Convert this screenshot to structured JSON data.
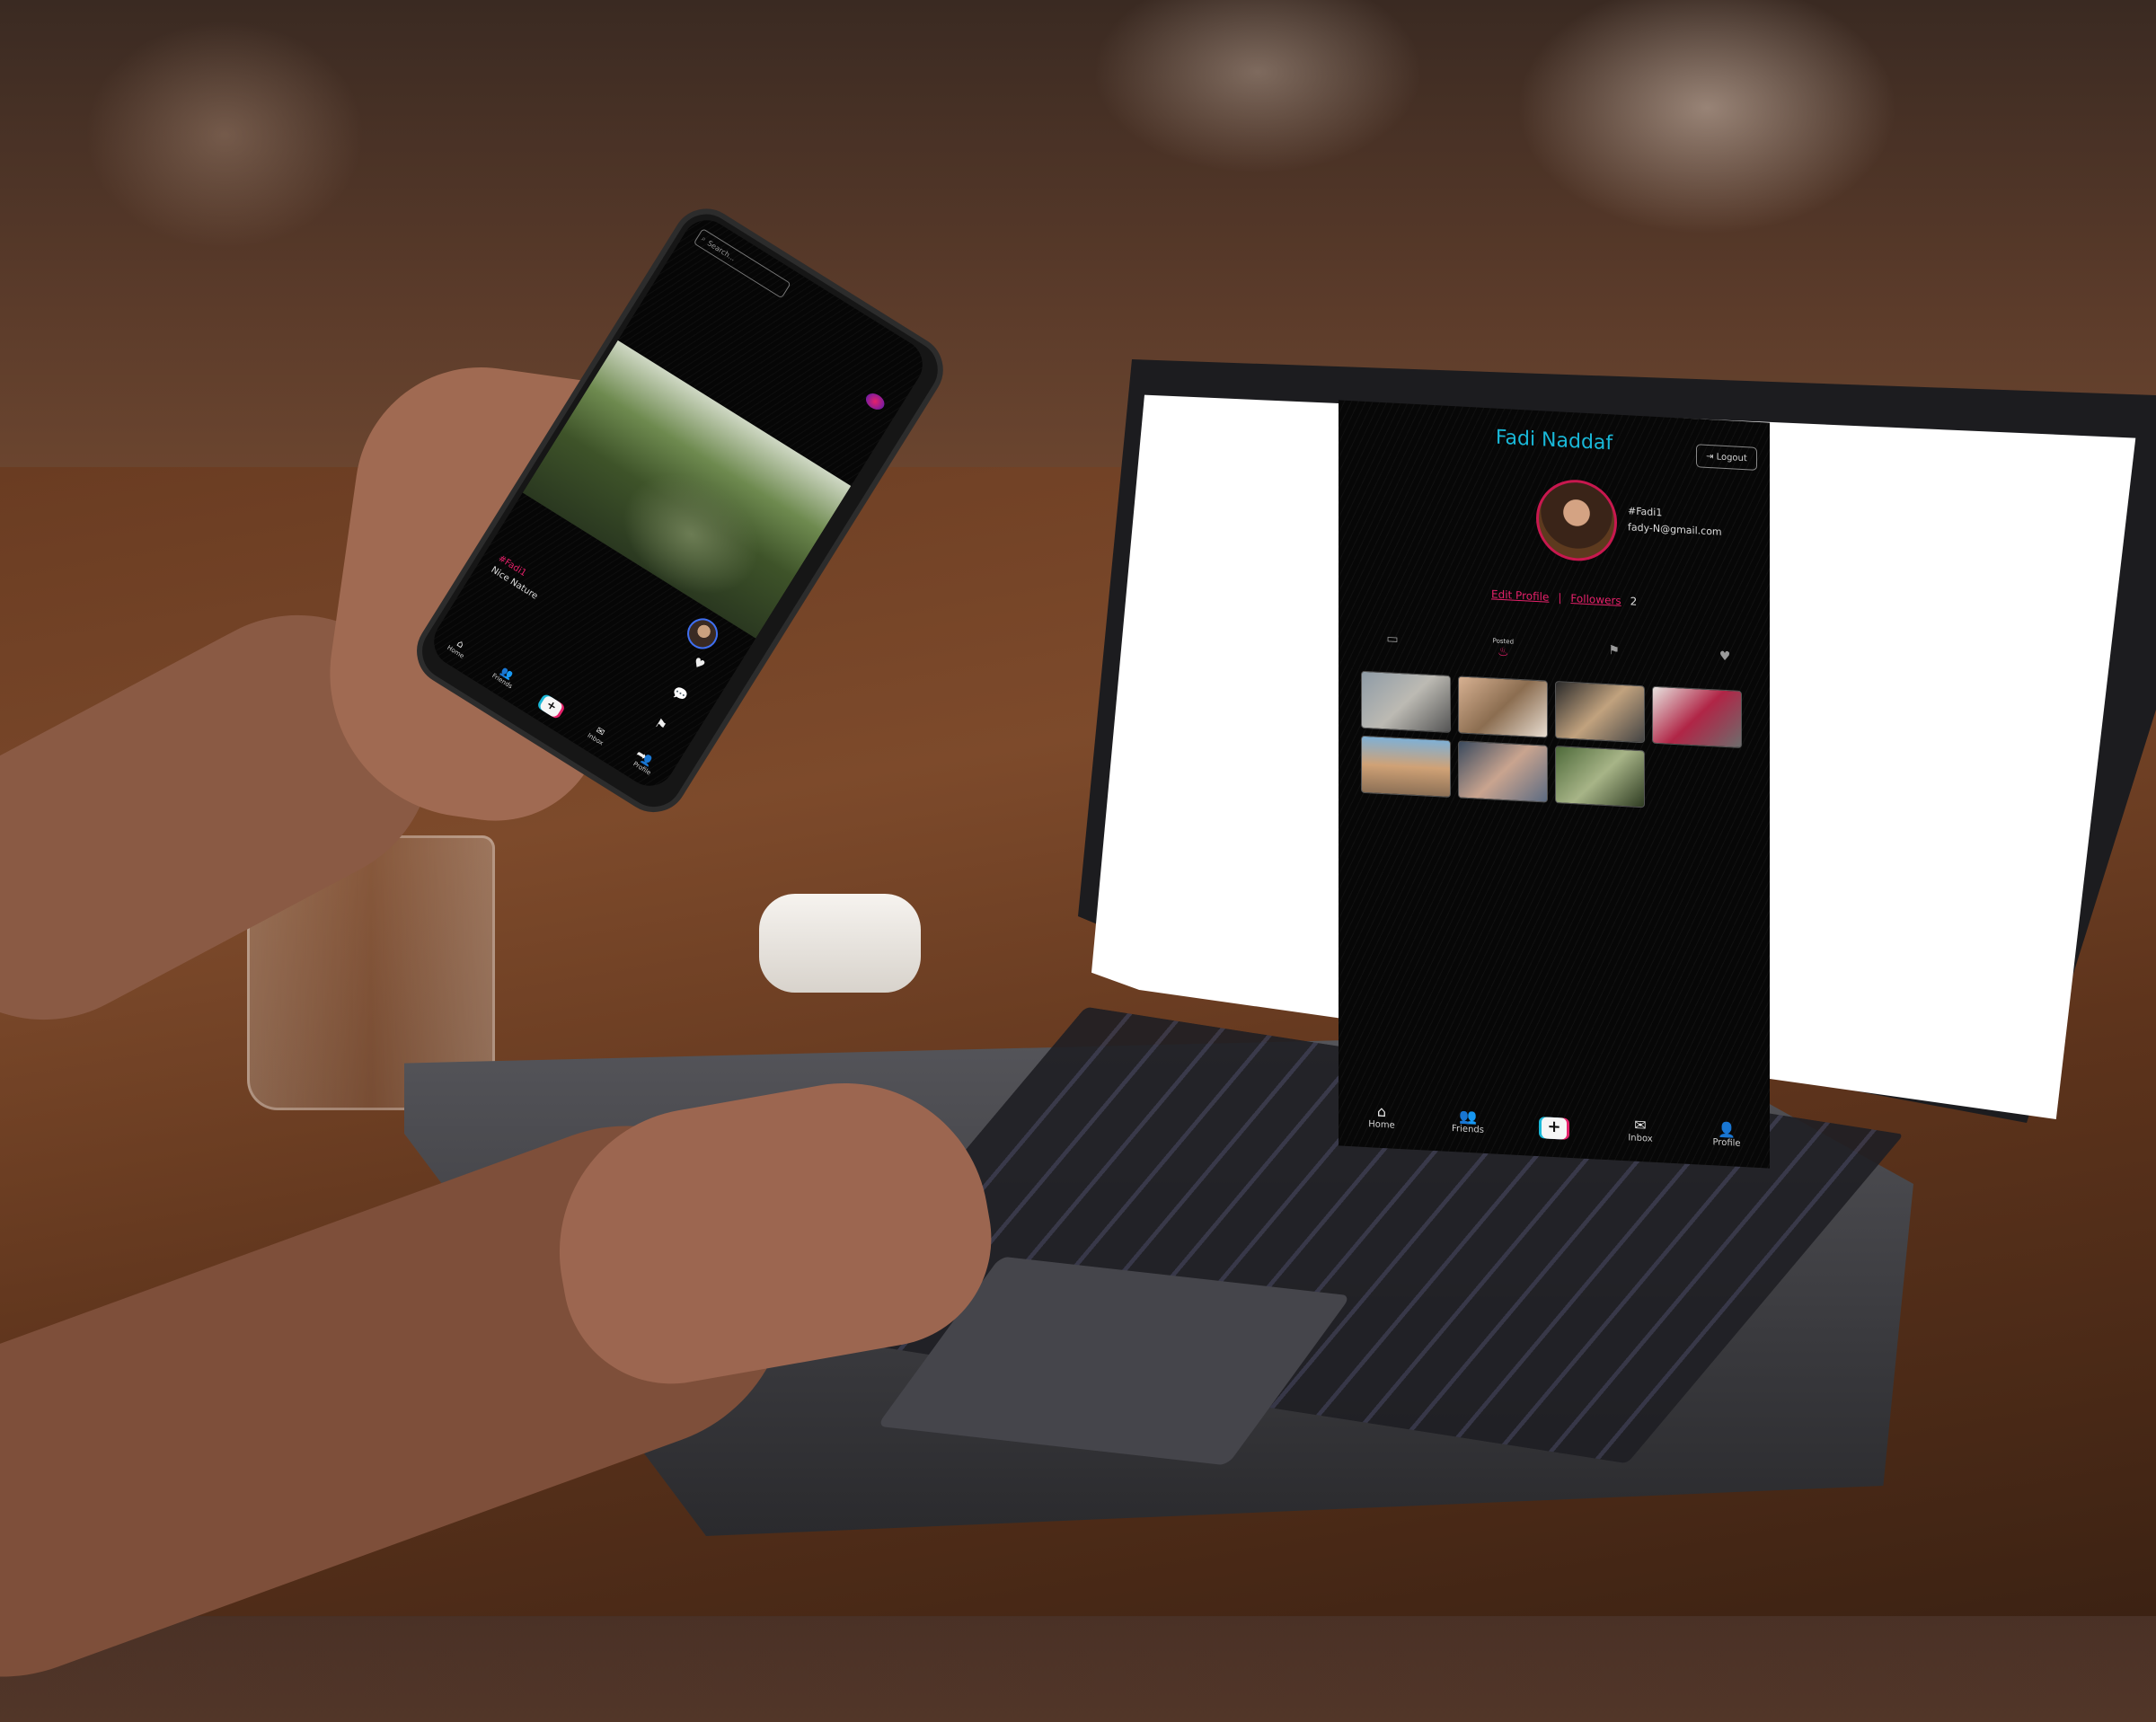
{
  "laptop_app": {
    "title": "Fadi Naddaf",
    "logout_label": "Logout",
    "handle": "#Fadi1",
    "email": "fady-N@gmail.com",
    "edit_profile_label": "Edit Profile",
    "separator": "|",
    "followers_label": "Followers",
    "followers_count": "2",
    "tabs": [
      {
        "icon": "folder-icon",
        "label": ""
      },
      {
        "icon": "heart-fire-icon",
        "label": "Posted"
      },
      {
        "icon": "bookmark-icon",
        "label": ""
      },
      {
        "icon": "heart-icon",
        "label": ""
      }
    ],
    "nav": {
      "home": "Home",
      "friends": "Friends",
      "inbox": "Inbox",
      "profile": "Profile",
      "plus": "+"
    }
  },
  "phone_app": {
    "search_placeholder": "Search...",
    "video_handle": "#Fadi1",
    "video_caption": "Nice Nature",
    "nav": {
      "home": "Home",
      "friends": "Friends",
      "inbox": "Inbox",
      "profile": "Profile",
      "plus": "+"
    }
  },
  "colors": {
    "accent_pink": "#e5216a",
    "accent_cyan": "#19b8d8",
    "app_bg": "#0a0a0a"
  }
}
